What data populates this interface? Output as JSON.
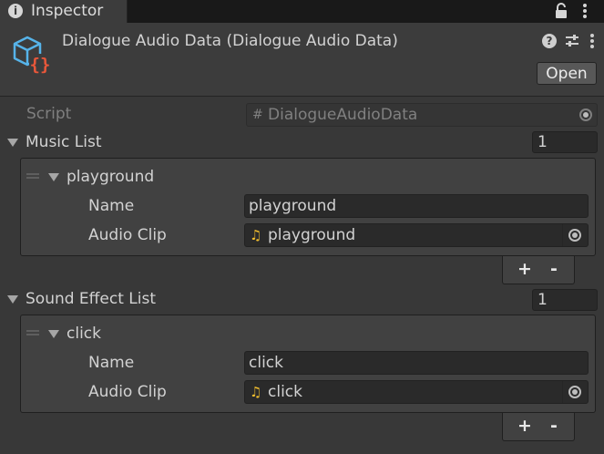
{
  "tab": {
    "label": "Inspector",
    "icon": "info-icon"
  },
  "header": {
    "title": "Dialogue Audio Data (Dialogue Audio Data)",
    "open_label": "Open"
  },
  "script_row": {
    "label": "Script",
    "value": "DialogueAudioData"
  },
  "lists": [
    {
      "label": "Music List",
      "count": "1",
      "element": {
        "title": "playground",
        "name_label": "Name",
        "name_value": "playground",
        "clip_label": "Audio Clip",
        "clip_value": "playground"
      }
    },
    {
      "label": "Sound Effect List",
      "count": "1",
      "element": {
        "title": "click",
        "name_label": "Name",
        "name_value": "click",
        "clip_label": "Audio Clip",
        "clip_value": "click"
      }
    }
  ],
  "footer": {
    "add_label": "+",
    "remove_label": "-"
  },
  "colors": {
    "background": "#383838",
    "tab_bar": "#191919",
    "field": "#2a2a2a",
    "panel": "#414141",
    "audio_icon": "#f0bd2e",
    "script_icon_orange": "#e8573a",
    "script_icon_blue": "#56b3e9"
  }
}
